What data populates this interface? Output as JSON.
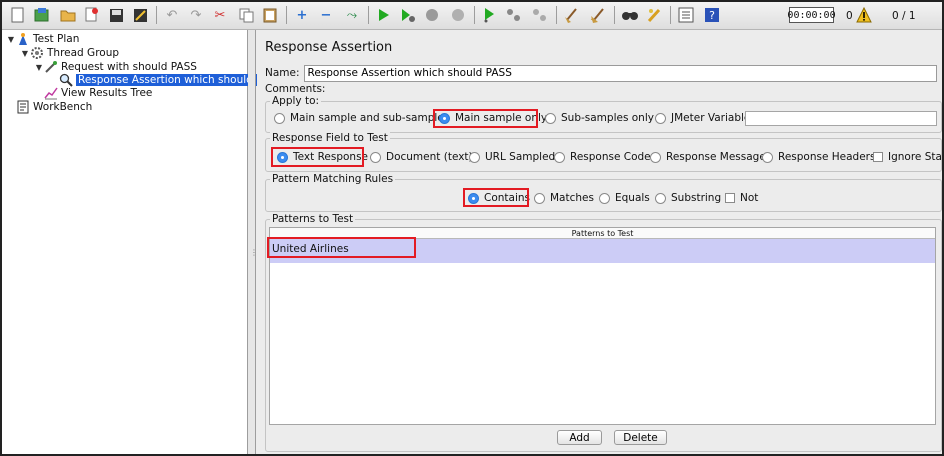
{
  "toolbar": {
    "icons": [
      "new-icon",
      "templates-icon",
      "open-icon",
      "close-icon",
      "save-icon",
      "save-as-icon",
      "undo-icon",
      "redo-icon",
      "cut-icon",
      "copy-icon",
      "paste-icon",
      "expand-icon",
      "collapse-icon",
      "toggle-icon",
      "start-icon",
      "start-no-pause-icon",
      "stop-icon",
      "shutdown-icon",
      "remote-start-icon",
      "remote-stop-icon",
      "remote-shutdown-icon",
      "clear-icon",
      "clear-all-icon",
      "search-icon",
      "reset-search-icon",
      "function-helper-icon",
      "help-icon"
    ],
    "timer": "00:00:00",
    "error_count": "0",
    "thread_count": "0 / 1"
  },
  "tree": {
    "items": [
      {
        "label": "Test Plan",
        "icon": "test-plan-icon"
      },
      {
        "label": "Thread Group",
        "icon": "gear-icon"
      },
      {
        "label": "Request with should PASS",
        "icon": "sampler-icon"
      },
      {
        "label": "Response Assertion which should PASS",
        "icon": "magnifier-icon"
      },
      {
        "label": "View Results Tree",
        "icon": "listener-icon"
      },
      {
        "label": "WorkBench",
        "icon": "workbench-icon"
      }
    ]
  },
  "panel": {
    "title": "Response Assertion",
    "name_label": "Name:",
    "name_value": "Response Assertion which should PASS",
    "comments_label": "Comments:",
    "apply_to": {
      "title": "Apply to:",
      "options": [
        "Main sample and sub-samples",
        "Main sample only",
        "Sub-samples only",
        "JMeter Variable"
      ],
      "selected": "Main sample only"
    },
    "response_field": {
      "title": "Response Field to Test",
      "options": [
        "Text Response",
        "Document (text)",
        "URL Sampled",
        "Response Code",
        "Response Message",
        "Response Headers"
      ],
      "checkbox": "Ignore Status",
      "selected": "Text Response"
    },
    "pattern_rules": {
      "title": "Pattern Matching Rules",
      "options": [
        "Contains",
        "Matches",
        "Equals",
        "Substring"
      ],
      "checkbox": "Not",
      "selected": "Contains"
    },
    "patterns": {
      "title": "Patterns to Test",
      "column_header": "Patterns to Test",
      "rows": [
        "United Airlines"
      ]
    },
    "buttons": {
      "add": "Add",
      "delete": "Delete"
    }
  },
  "colors": {
    "highlight": "#e31b23",
    "selection": "#1e5fd8",
    "table_row": "#ccccf6"
  }
}
